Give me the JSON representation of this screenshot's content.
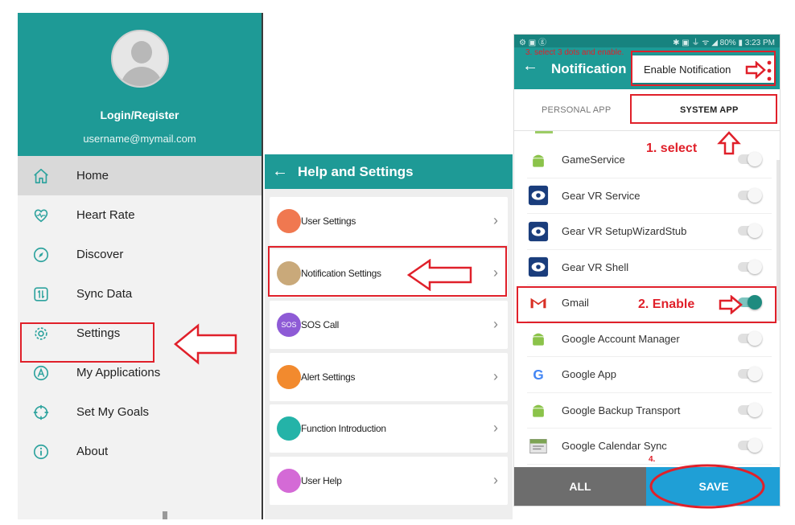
{
  "panel_drawer": {
    "login_label": "Login/Register",
    "email": "username@mymail.com",
    "menu": [
      {
        "label": "Home",
        "icon": "home-icon",
        "active": true
      },
      {
        "label": "Heart Rate",
        "icon": "heart-icon",
        "active": false
      },
      {
        "label": "Discover",
        "icon": "compass-icon",
        "active": false
      },
      {
        "label": "Sync Data",
        "icon": "sync-icon",
        "active": false
      },
      {
        "label": "Settings",
        "icon": "gear-icon",
        "active": false
      },
      {
        "label": "My Applications",
        "icon": "apps-icon",
        "active": false
      },
      {
        "label": "Set My Goals",
        "icon": "target-icon",
        "active": false
      },
      {
        "label": "About",
        "icon": "info-icon",
        "active": false
      }
    ]
  },
  "panel_help": {
    "back_icon": "←",
    "title": "Help and Settings",
    "items": [
      {
        "label": "User Settings",
        "icon_color": "#f07850",
        "icon_text": ""
      },
      {
        "label": "Notification Settings",
        "icon_color": "#c9a97a",
        "icon_text": ""
      },
      {
        "label": "SOS Call",
        "icon_color": "#8e5bd6",
        "icon_text": "SOS"
      },
      {
        "label": "Alert Settings",
        "icon_color": "#f28a2e",
        "icon_text": ""
      },
      {
        "label": "Function Introduction",
        "icon_color": "#24b3a8",
        "icon_text": ""
      },
      {
        "label": "User Help",
        "icon_color": "#d46ad6",
        "icon_text": ""
      }
    ],
    "chevron": "›"
  },
  "panel_notification": {
    "status_left": "⚙ ▣ ⓖ",
    "status_right": "✱ ▣ ⏚ ᯤ ◢ 80% ▮ 3:23 PM",
    "back_icon": "←",
    "title": "Notification",
    "hint": "3. select 3 dots and enable.",
    "popup_label": "Enable Notification",
    "tab_personal": "PERSONAL APP",
    "tab_system": "SYSTEM APP",
    "apps": [
      {
        "name": "GameService",
        "icon": "android-icon",
        "on": false
      },
      {
        "name": "Gear VR Service",
        "icon": "gear-vr-icon",
        "on": false
      },
      {
        "name": "Gear VR SetupWizardStub",
        "icon": "gear-vr-icon",
        "on": false
      },
      {
        "name": "Gear VR Shell",
        "icon": "gear-vr-icon",
        "on": false
      },
      {
        "name": "Gmail",
        "icon": "gmail-icon",
        "on": true
      },
      {
        "name": "Google Account Manager",
        "icon": "android-icon",
        "on": false
      },
      {
        "name": "Google App",
        "icon": "google-icon",
        "on": false
      },
      {
        "name": "Google Backup Transport",
        "icon": "android-icon",
        "on": false
      },
      {
        "name": "Google Calendar Sync",
        "icon": "calendar-icon",
        "on": false
      }
    ],
    "btn_all": "ALL",
    "btn_save": "SAVE"
  },
  "annotations": {
    "step1": "1. select",
    "step2": "2. Enable",
    "step4": "4."
  },
  "colors": {
    "teal": "#1e9a96",
    "red": "#e0202a",
    "save_blue": "#1f9fd6"
  }
}
